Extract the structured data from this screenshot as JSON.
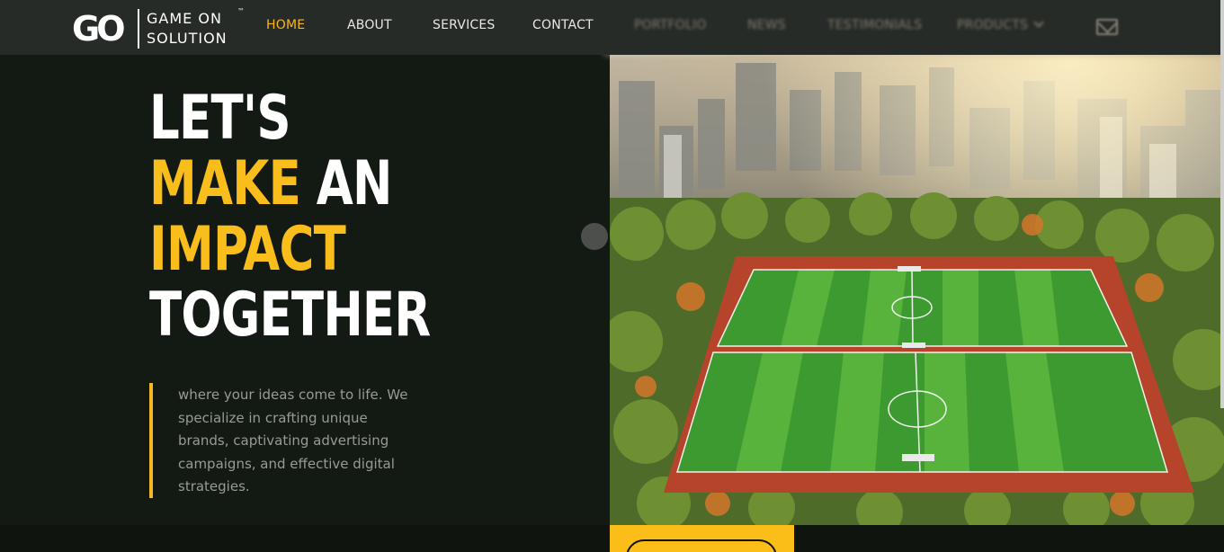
{
  "brand": {
    "mark": "GO",
    "line1": "GAME ON",
    "line2": "SOLUTION",
    "trademark": "™"
  },
  "nav": {
    "items": [
      {
        "label": "HOME",
        "active": true
      },
      {
        "label": "ABOUT"
      },
      {
        "label": "SERVICES"
      },
      {
        "label": "CONTACT"
      },
      {
        "label": "PORTFOLIO"
      },
      {
        "label": "NEWS"
      },
      {
        "label": "TESTIMONIALS"
      },
      {
        "label": "PRODUCTS"
      }
    ],
    "mail_icon": "mail-icon",
    "products_icon": "chevron-down-icon"
  },
  "hero": {
    "line1": "LET'S",
    "line2_highlight": "MAKE",
    "line2_rest": "AN",
    "line3_highlight": "IMPACT",
    "line4": "TOGETHER",
    "tagline": "where your ideas come to life. We specialize in crafting unique brands, captivating advertising campaigns, and effective digital strategies."
  },
  "colors": {
    "accent": "#f9bd1c",
    "background": "#131913",
    "navbar": "#272b27",
    "text": "#ffffff",
    "muted_text": "#999b95"
  }
}
